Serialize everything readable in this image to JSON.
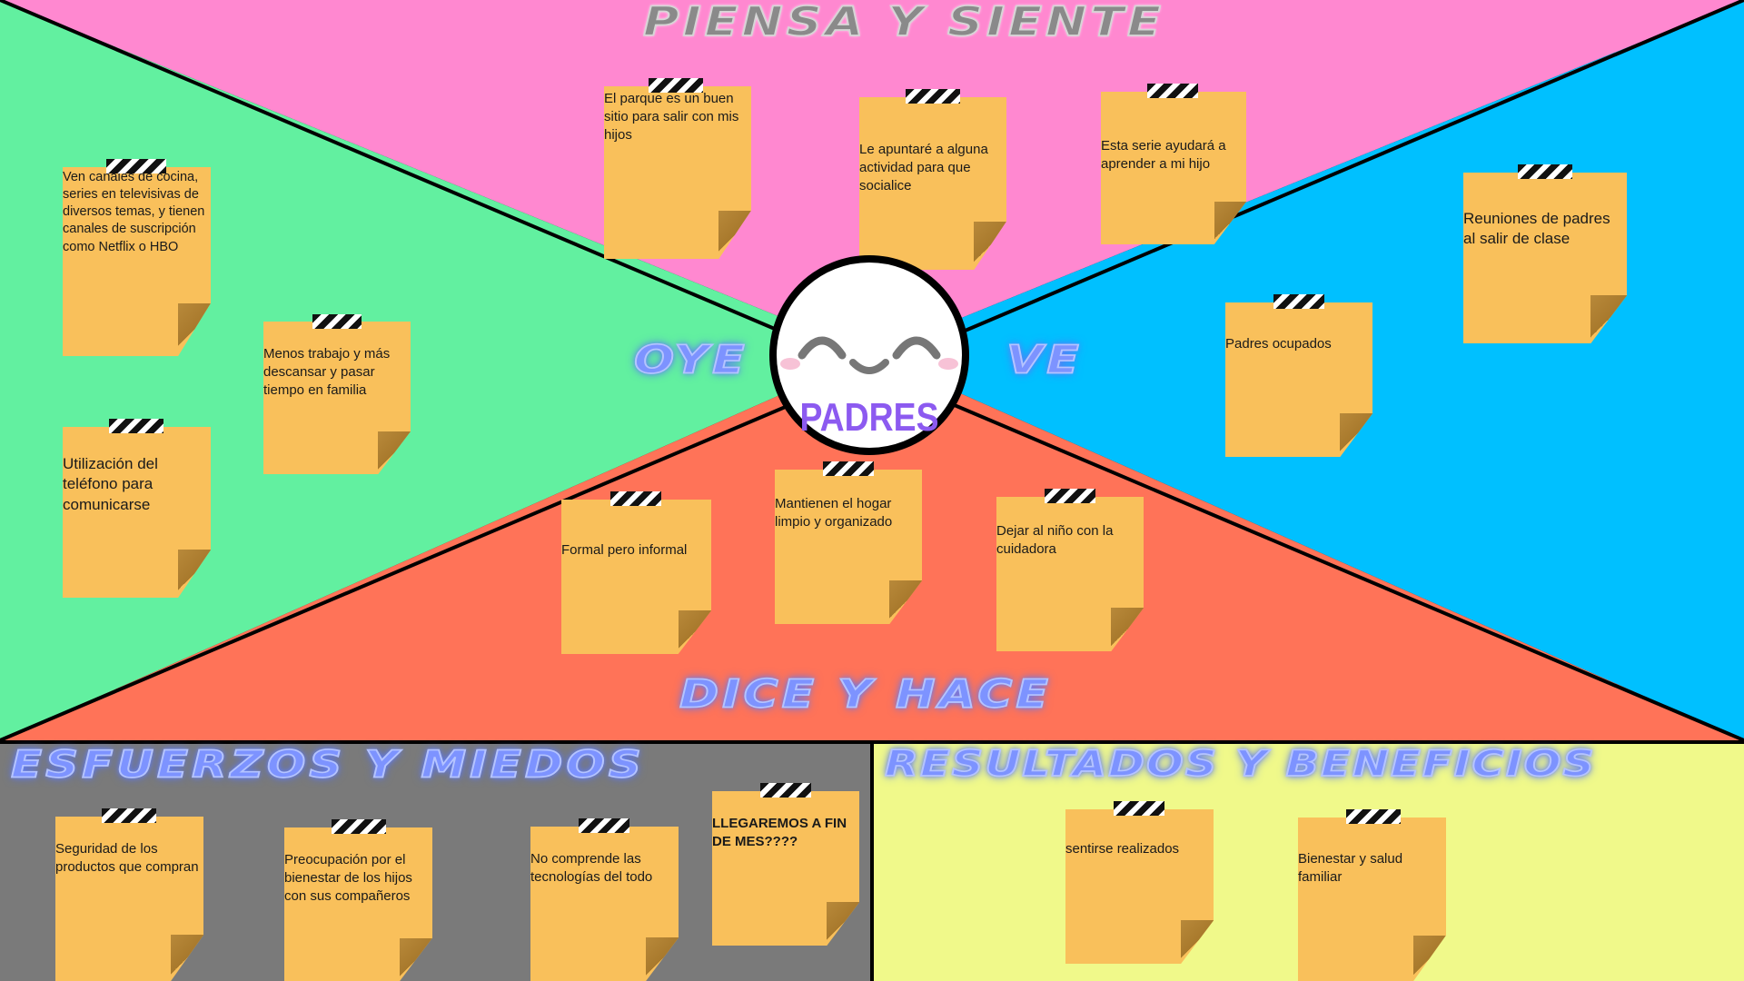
{
  "colors": {
    "piensa": "#ff88d0",
    "oye": "#62f0a0",
    "ve": "#00c0ff",
    "dice": "#ff7358",
    "esfuerzos": "#7a7a7a",
    "resultados": "#f0f98a",
    "note": "#f9c05b",
    "persona_label": "#8c5af0"
  },
  "sections": {
    "piensa": "PIENSA Y SIENTE",
    "oye": "OYE",
    "ve": "VE",
    "dice": "DICE Y HACE",
    "esfuerzos": "ESFUERZOS Y MIEDOS",
    "resultados": "RESULTADOS Y BENEFICIOS"
  },
  "persona": {
    "label": "PADRES",
    "icon": "smiley-face-icon"
  },
  "notes": {
    "piensa": [
      "El parque es un buen sitio para salir con mis hijos",
      "Le apuntaré a alguna actividad para que socialice",
      "Esta serie ayudará a aprender a mi hijo"
    ],
    "oye": [
      "Ven canales de cocina, series en televisivas de diversos temas, y tienen canales de suscripción como Netflix o HBO",
      "Menos trabajo y más descansar y pasar tiempo en familia",
      "Utilización del teléfono para comunicarse"
    ],
    "ve": [
      "Reuniones de padres al salir de clase",
      "Padres ocupados"
    ],
    "dice": [
      "Formal pero informal",
      "Mantienen el hogar limpio y organizado",
      "Dejar al niño con la cuidadora"
    ],
    "esfuerzos": [
      "Seguridad de los productos que compran",
      "Preocupación por el bienestar de los hijos con sus compañeros",
      "No comprende las tecnologías del todo",
      "LLEGAREMOS A FIN DE MES????"
    ],
    "resultados": [
      "sentirse realizados",
      "Bienestar y salud familiar"
    ]
  }
}
